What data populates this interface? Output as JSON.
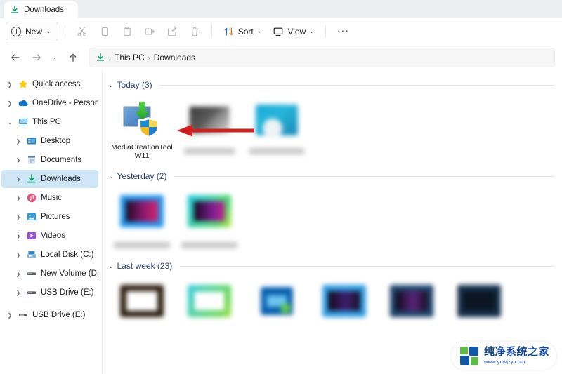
{
  "window": {
    "tab": {
      "title": "Downloads",
      "icon": "download-icon"
    }
  },
  "toolbar": {
    "new_label": "New",
    "cut_label": "Cut",
    "copy_label": "Copy",
    "paste_label": "Paste",
    "rename_label": "Rename",
    "share_label": "Share",
    "delete_label": "Delete",
    "sort_label": "Sort",
    "view_label": "View",
    "more_label": "···"
  },
  "addressbar": {
    "back_label": "←",
    "forward_label": "→",
    "recent_label": "⌄",
    "up_label": "↑",
    "breadcrumbs": [
      "This PC",
      "Downloads"
    ],
    "separator": "›"
  },
  "sidebar": {
    "items": [
      {
        "label": "Quick access",
        "icon": "star-icon",
        "level": 1,
        "expanded": false,
        "selected": false
      },
      {
        "label": "OneDrive - Personal",
        "icon": "cloud-icon",
        "level": 1,
        "expanded": false,
        "selected": false
      },
      {
        "label": "This PC",
        "icon": "pc-icon",
        "level": 1,
        "expanded": true,
        "selected": false
      },
      {
        "label": "Desktop",
        "icon": "desktop-icon",
        "level": 2,
        "expanded": false,
        "selected": false
      },
      {
        "label": "Documents",
        "icon": "documents-icon",
        "level": 2,
        "expanded": false,
        "selected": false
      },
      {
        "label": "Downloads",
        "icon": "download-icon",
        "level": 2,
        "expanded": false,
        "selected": true
      },
      {
        "label": "Music",
        "icon": "music-icon",
        "level": 2,
        "expanded": false,
        "selected": false
      },
      {
        "label": "Pictures",
        "icon": "pictures-icon",
        "level": 2,
        "expanded": false,
        "selected": false
      },
      {
        "label": "Videos",
        "icon": "videos-icon",
        "level": 2,
        "expanded": false,
        "selected": false
      },
      {
        "label": "Local Disk (C:)",
        "icon": "disk-icon",
        "level": 2,
        "expanded": false,
        "selected": false
      },
      {
        "label": "New Volume (D:)",
        "icon": "drive-icon",
        "level": 2,
        "expanded": false,
        "selected": false
      },
      {
        "label": "USB Drive (E:)",
        "icon": "drive-icon",
        "level": 2,
        "expanded": false,
        "selected": false
      },
      {
        "label": "USB Drive (E:)",
        "icon": "drive-icon",
        "level": 1,
        "expanded": false,
        "selected": false
      }
    ]
  },
  "content": {
    "groups": [
      {
        "label": "Today (3)",
        "items": [
          {
            "label": "MediaCreationToolW11",
            "blurred": false,
            "thumb": "media-creation-tool-icon"
          },
          {
            "label": "",
            "blurred": true,
            "thumb": "dark-screenshot"
          },
          {
            "label": "",
            "blurred": true,
            "thumb": "teal-screenshot"
          }
        ]
      },
      {
        "label": "Yesterday (2)",
        "items": [
          {
            "label": "",
            "blurred": true,
            "thumb": "blue-video-thumb"
          },
          {
            "label": "",
            "blurred": true,
            "thumb": "green-video-thumb"
          }
        ]
      },
      {
        "label": "Last week (23)",
        "items": [
          {
            "label": "",
            "blurred": true,
            "thumb": "brown-white-thumb"
          },
          {
            "label": "",
            "blurred": true,
            "thumb": "green-white-thumb"
          },
          {
            "label": "",
            "blurred": true,
            "thumb": "blue-app-thumb"
          },
          {
            "label": "",
            "blurred": true,
            "thumb": "blue-dark-thumb"
          },
          {
            "label": "",
            "blurred": true,
            "thumb": "darkblue-thumb"
          },
          {
            "label": "",
            "blurred": true,
            "thumb": "navy-thumb"
          }
        ]
      }
    ]
  },
  "annotation": {
    "arrow_color": "#d41f1f",
    "points_to": "MediaCreationToolW11"
  },
  "watermark": {
    "name": "纯净系统之家",
    "url": "www.ycwjzy.com"
  },
  "colors": {
    "selection": "#cfe6f7",
    "group_header": "#2c4470",
    "accent_green": "#11a05e"
  }
}
